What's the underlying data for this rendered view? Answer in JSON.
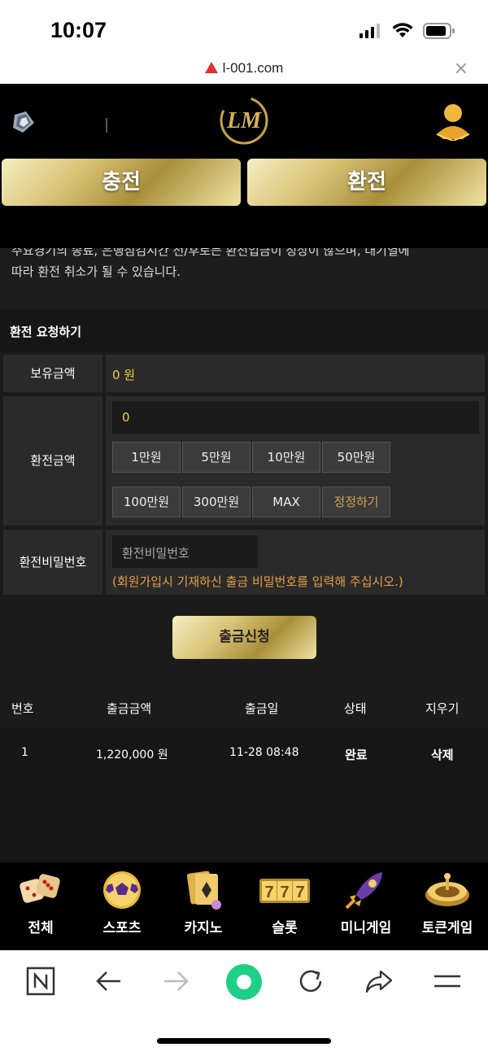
{
  "status_bar": {
    "time": "10:07"
  },
  "url_bar": {
    "url": "l-001.com"
  },
  "header": {
    "logo_text": "LM",
    "buttons": {
      "charge": "충전",
      "exchange": "환전"
    }
  },
  "notice": {
    "line1": "주요경기의 종료, 은행점검시간 전/후로는 환전입금이 정상이 않으며, 대기열에",
    "line2": "따라 환전 취소가 될 수 있습니다."
  },
  "form": {
    "title": "환전 요청하기",
    "balance_label": "보유금액",
    "balance_value": "0 원",
    "amount_label": "환전금액",
    "amount_value": "0",
    "amount_buttons": [
      "1만원",
      "5만원",
      "10만원",
      "50만원",
      "100만원",
      "300만원",
      "MAX",
      "정정하기"
    ],
    "password_label": "환전비밀번호",
    "password_placeholder": "환전비밀번호",
    "password_hint": "(회원가입시 기재하신 출금 비밀번호를 입력해 주십시오.)",
    "submit": "출금신청"
  },
  "table": {
    "headers": [
      "번호",
      "출금금액",
      "출금일",
      "상태",
      "지우기"
    ],
    "rows": [
      {
        "no": "1",
        "amount": "1,220,000 원",
        "date": "11-28 08:48",
        "status": "완료",
        "action": "삭제"
      }
    ]
  },
  "game_nav": [
    {
      "label": "전체",
      "icon": "dice-icon"
    },
    {
      "label": "스포츠",
      "icon": "soccer-ball-icon"
    },
    {
      "label": "카지노",
      "icon": "cards-icon"
    },
    {
      "label": "슬롯",
      "icon": "slot-777-icon"
    },
    {
      "label": "미니게임",
      "icon": "rocket-icon"
    },
    {
      "label": "토큰게임",
      "icon": "roulette-icon"
    }
  ],
  "toolbar": {
    "icons": [
      "naver-n-icon",
      "back-arrow-icon",
      "forward-arrow-icon",
      "home-green-icon",
      "reload-icon",
      "share-icon",
      "menu-icon"
    ]
  },
  "colors": {
    "gold_text": "#f5d03d",
    "hint_orange": "#e5a04a",
    "panel_bg": "#2a2a2a",
    "page_bg": "#1b1b1b"
  }
}
